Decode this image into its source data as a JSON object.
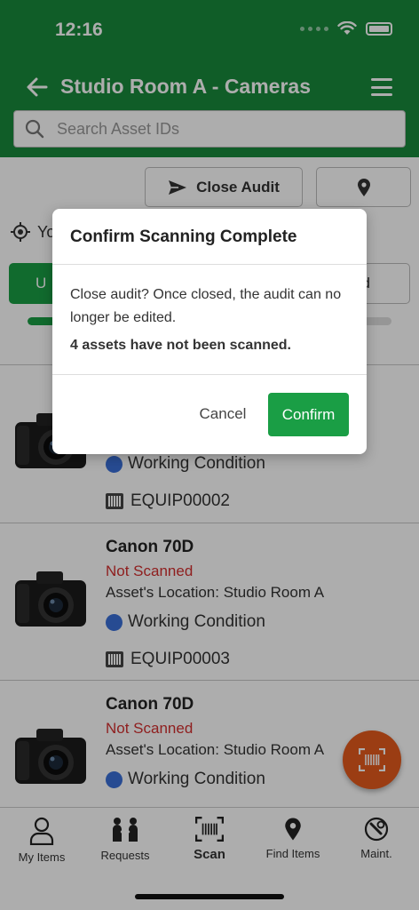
{
  "status_bar": {
    "time": "12:16"
  },
  "header": {
    "title": "Studio Room A - Cameras",
    "search_placeholder": "Search Asset IDs"
  },
  "toolbar": {
    "close_audit_label": "Close Audit"
  },
  "location_row": {
    "label_fragment": "Yo"
  },
  "segments": {
    "left_fragment": "U",
    "right_fragment": "d"
  },
  "progress": {
    "fraction": 0.33
  },
  "assets": [
    {
      "condition": "Working Condition",
      "code": "EQUIP00002"
    },
    {
      "name": "Canon 70D",
      "status": "Not Scanned",
      "location": "Asset's Location: Studio Room A",
      "condition": "Working Condition",
      "code": "EQUIP00003"
    },
    {
      "name": "Canon 70D",
      "status": "Not Scanned",
      "location": "Asset's Location: Studio Room A",
      "condition": "Working Condition"
    }
  ],
  "bottom_nav": [
    {
      "label": "My Items",
      "icon": "person-icon"
    },
    {
      "label": "Requests",
      "icon": "requests-icon"
    },
    {
      "label": "Scan",
      "icon": "barcode-scan-icon"
    },
    {
      "label": "Find Items",
      "icon": "map-pin-icon"
    },
    {
      "label": "Maint.",
      "icon": "maintenance-icon"
    }
  ],
  "dialog": {
    "title": "Confirm Scanning Complete",
    "message": "Close audit? Once closed, the audit can no longer be edited.",
    "warning": "4 assets have not been scanned.",
    "cancel_label": "Cancel",
    "confirm_label": "Confirm"
  },
  "colors": {
    "brand_green": "#188a3c",
    "accent_green": "#1a9e45",
    "fab_orange": "#e55a1c",
    "not_scanned_red": "#d32f2f",
    "condition_blue": "#3a6fd8"
  }
}
